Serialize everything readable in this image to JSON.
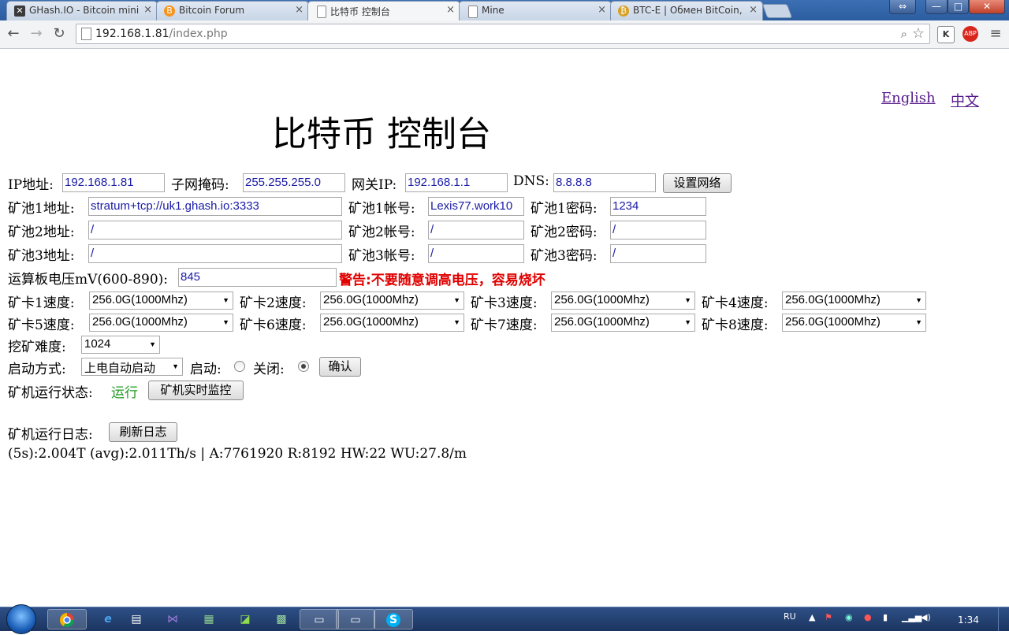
{
  "browser": {
    "tabs": [
      {
        "title": "GHash.IO - Bitcoin mining",
        "icon": "ghash-icon",
        "active": false
      },
      {
        "title": "Bitcoin Forum",
        "icon": "bitcoin-icon",
        "active": false
      },
      {
        "title": "比特币 控制台",
        "icon": "page-icon",
        "active": true
      },
      {
        "title": "Mine",
        "icon": "page-icon",
        "active": false
      },
      {
        "title": "BTC-E | Обмен BitCoin, Г",
        "icon": "btce-icon",
        "active": false
      }
    ],
    "tab_close": "×",
    "address": {
      "host": "192.168.1.81",
      "path": "/index.php"
    },
    "nav": {
      "back": "←",
      "forward": "→",
      "reload": "↻"
    },
    "ext_k": "K",
    "ext_abp": "ABP",
    "menu": "≡",
    "zoom_icon": "⌕",
    "star_icon": "☆",
    "win": {
      "switch": "⇔",
      "min": "—",
      "max": "□",
      "close": "✕"
    }
  },
  "page": {
    "lang_en": "English",
    "lang_zh": "中文",
    "title": "比特币 控制台",
    "network": {
      "ip_label": "IP地址:",
      "ip": "192.168.1.81",
      "mask_label": "子网掩码:",
      "mask": "255.255.255.0",
      "gw_label": "网关IP:",
      "gw": "192.168.1.1",
      "dns_label": "DNS:",
      "dns": "8.8.8.8",
      "set_btn": "设置网络"
    },
    "pools": [
      {
        "addr_label": "矿池1地址:",
        "addr": "stratum+tcp://uk1.ghash.io:3333",
        "user_label": "矿池1帐号:",
        "user": "Lexis77.work10",
        "pass_label": "矿池1密码:",
        "pass": "1234"
      },
      {
        "addr_label": "矿池2地址:",
        "addr": "/",
        "user_label": "矿池2帐号:",
        "user": "/",
        "pass_label": "矿池2密码:",
        "pass": "/"
      },
      {
        "addr_label": "矿池3地址:",
        "addr": "/",
        "user_label": "矿池3帐号:",
        "user": "/",
        "pass_label": "矿池3密码:",
        "pass": "/"
      }
    ],
    "voltage": {
      "label": "运算板电压mV(600-890):",
      "value": "845",
      "warning": "警告:不要随意调高电压，容易烧坏"
    },
    "cards": [
      {
        "label": "矿卡1速度:",
        "value": "256.0G(1000Mhz)"
      },
      {
        "label": "矿卡2速度:",
        "value": "256.0G(1000Mhz)"
      },
      {
        "label": "矿卡3速度:",
        "value": "256.0G(1000Mhz)"
      },
      {
        "label": "矿卡4速度:",
        "value": "256.0G(1000Mhz)"
      },
      {
        "label": "矿卡5速度:",
        "value": "256.0G(1000Mhz)"
      },
      {
        "label": "矿卡6速度:",
        "value": "256.0G(1000Mhz)"
      },
      {
        "label": "矿卡7速度:",
        "value": "256.0G(1000Mhz)"
      },
      {
        "label": "矿卡8速度:",
        "value": "256.0G(1000Mhz)"
      }
    ],
    "difficulty": {
      "label": "挖矿难度:",
      "value": "1024"
    },
    "startup": {
      "label": "启动方式:",
      "value": "上电自动启动",
      "on_label": "启动:",
      "off_label": "关闭:",
      "confirm": "确认"
    },
    "status": {
      "label": "矿机运行状态:",
      "value": "运行",
      "monitor_btn": "矿机实时监控"
    },
    "log": {
      "label": "矿机运行日志:",
      "refresh_btn": "刷新日志",
      "line": "(5s):2.004T (avg):2.011Th/s | A:7761920 R:8192 HW:22 WU:27.8/m"
    }
  },
  "taskbar": {
    "lang": "RU",
    "time": "1:34"
  }
}
